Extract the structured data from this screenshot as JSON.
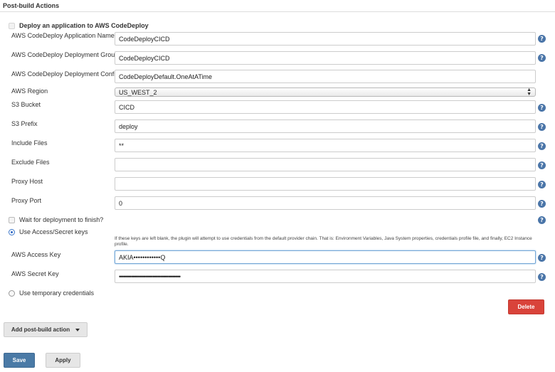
{
  "section": {
    "title": "Post-build Actions"
  },
  "deploy": {
    "checkbox_label": "Deploy an application to AWS CodeDeploy",
    "checked": false
  },
  "fields": [
    {
      "label": "AWS CodeDeploy Application Name",
      "value": "CodeDeployCICD"
    },
    {
      "label": "AWS CodeDeploy Deployment Group",
      "value": "CodeDeployCICD"
    },
    {
      "label": "AWS CodeDeploy Deployment Config",
      "value": "CodeDeployDefault.OneAtATime"
    },
    {
      "label": "AWS Region",
      "value": "US_WEST_2"
    },
    {
      "label": "S3 Bucket",
      "value": "CICD"
    },
    {
      "label": "S3 Prefix",
      "value": "deploy"
    },
    {
      "label": "Include Files",
      "value": "**"
    },
    {
      "label": "Exclude Files",
      "value": ""
    },
    {
      "label": "Proxy Host",
      "value": ""
    },
    {
      "label": "Proxy Port",
      "value": "0"
    }
  ],
  "wait": {
    "label": "Wait for deployment to finish?",
    "checked": false
  },
  "credentials": {
    "access_secret_label": "Use Access/Secret keys",
    "hint": "If these keys are left blank, the plugin will attempt to use credentials from the default provider chain. That is: Environment Variables, Java System properties, credentials profile file, and finally, EC2 Instance profile.",
    "access_key_label": "AWS Access Key",
    "access_key_value": "AKIA••••••••••••Q",
    "secret_key_label": "AWS Secret Key",
    "secret_key_value": "••••••••••••••••••••••••••••••••••••••••",
    "temporary_label": "Use temporary credentials",
    "selected": "access_secret"
  },
  "buttons": {
    "delete": "Delete",
    "add_post_build": "Add post-build action",
    "save": "Save",
    "apply": "Apply"
  },
  "help_glyph": "?",
  "colors": {
    "primary": "#4a7aa6",
    "danger": "#d9433a",
    "help": "#4a75a8"
  }
}
